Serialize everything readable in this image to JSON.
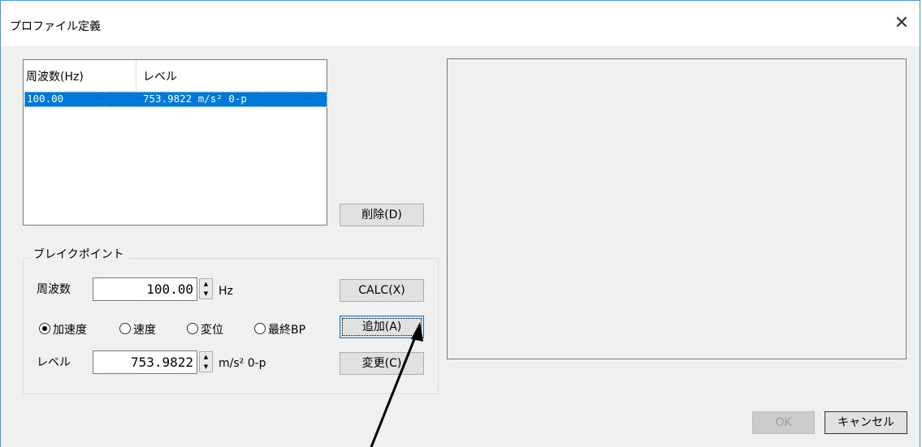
{
  "window": {
    "title": "プロファイル定義",
    "close_glyph": "✕"
  },
  "list": {
    "columns": [
      "周波数(Hz)",
      "レベル"
    ],
    "rows": [
      {
        "freq": "100.00",
        "level": "753.9822 m/s² 0-p"
      }
    ]
  },
  "buttons": {
    "delete": "削除(D)",
    "calc": "CALC(X)",
    "add": "追加(A)",
    "change": "変更(C)",
    "ok": "OK",
    "cancel": "キャンセル"
  },
  "breakpoint": {
    "group_label": "ブレイクポイント",
    "freq_label": "周波数",
    "freq_value": "100.00",
    "freq_unit": "Hz",
    "level_label": "レベル",
    "level_value": "753.9822",
    "level_unit": "m/s² 0-p",
    "radios": [
      {
        "label": "加速度",
        "selected": true
      },
      {
        "label": "速度",
        "selected": false
      },
      {
        "label": "変位",
        "selected": false
      },
      {
        "label": "最終BP",
        "selected": false
      }
    ]
  },
  "colors": {
    "selection": "#0078d7",
    "dialog_bg": "#f0f0f0",
    "border_accent": "#4a9bd1"
  }
}
